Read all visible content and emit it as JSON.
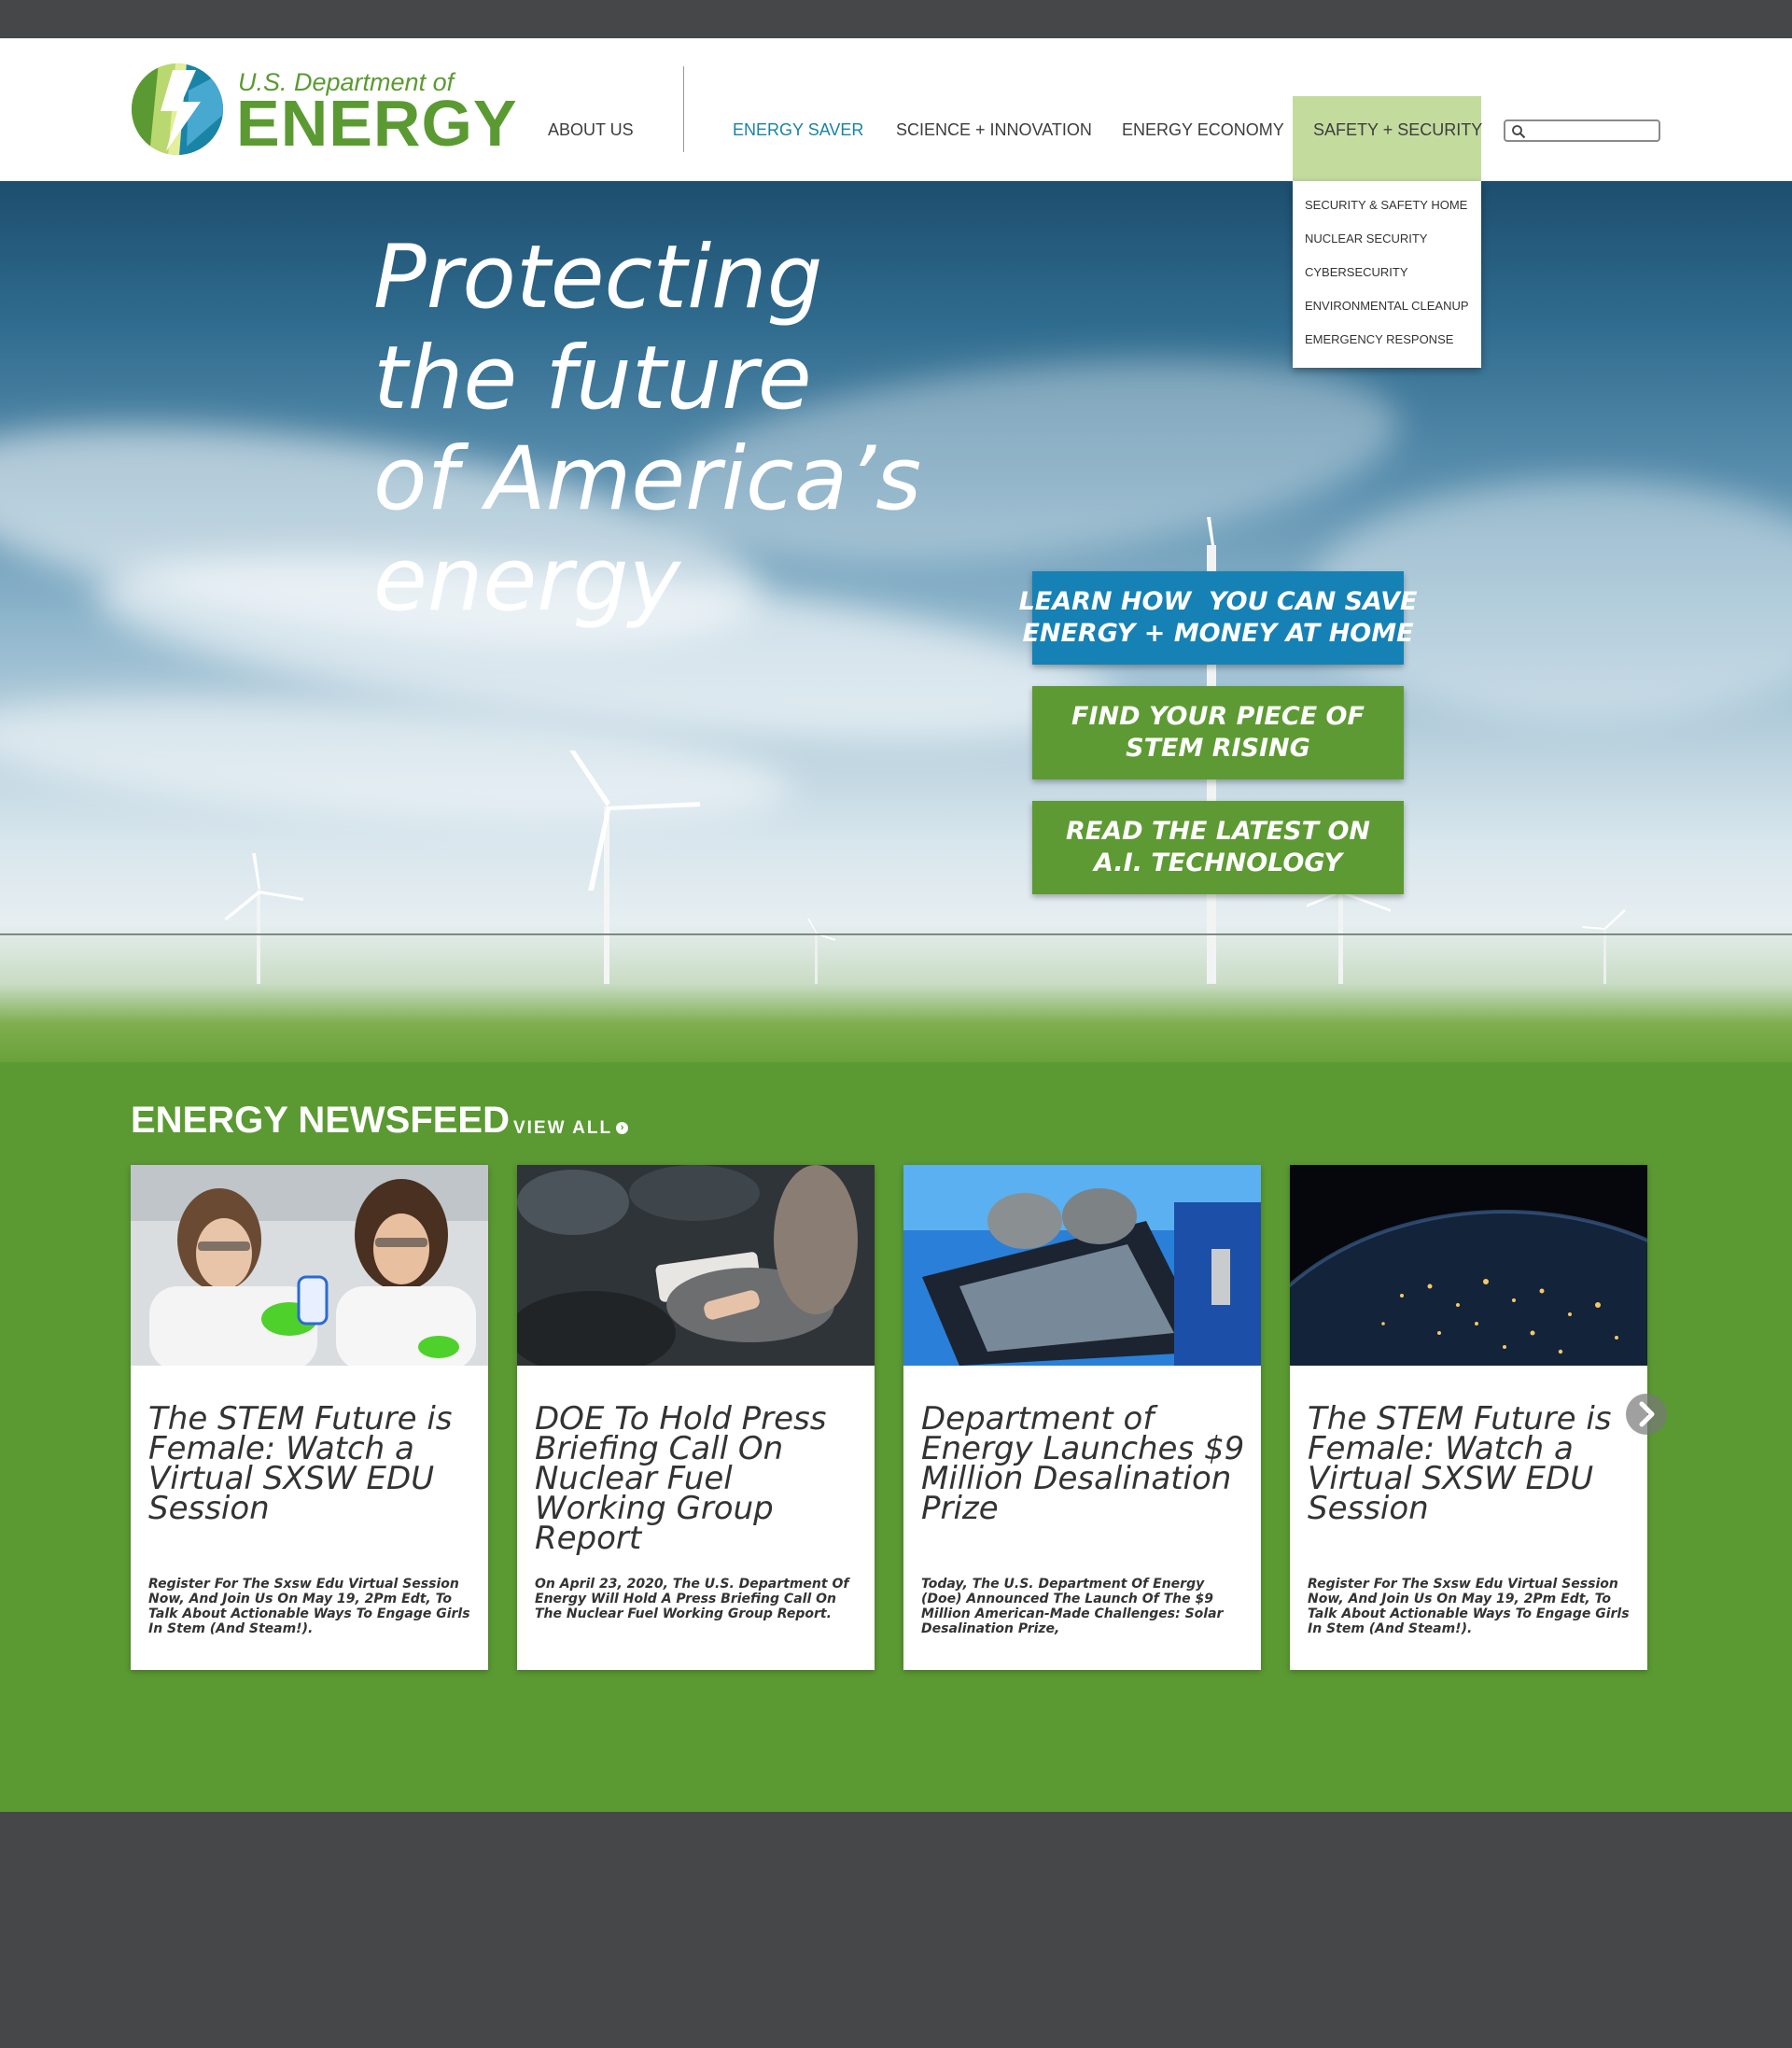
{
  "header": {
    "logo_small": "U.S. Department of",
    "logo_big": "ENERGY",
    "nav": [
      {
        "label": "ABOUT US"
      },
      {
        "label": "ENERGY SAVER"
      },
      {
        "label": "SCIENCE + INNOVATION"
      },
      {
        "label": "ENERGY ECONOMY"
      },
      {
        "label": "SAFETY + SECURITY"
      }
    ],
    "search_placeholder": ""
  },
  "dropdown": {
    "items": [
      {
        "label": "SECURITY & SAFETY HOME"
      },
      {
        "label": "NUCLEAR SECURITY"
      },
      {
        "label": "CYBERSECURITY"
      },
      {
        "label": "ENVIRONMENTAL CLEANUP"
      },
      {
        "label": "EMERGENCY RESPONSE"
      }
    ]
  },
  "hero": {
    "title_lines": [
      "Protecting",
      "the future",
      "of America’s",
      "energy"
    ],
    "ctas": [
      {
        "line1": "LEARN HOW  YOU CAN SAVE",
        "line2": "ENERGY + MONEY AT HOME"
      },
      {
        "line1": "FIND YOUR PIECE OF",
        "line2": "STEM RISING"
      },
      {
        "line1": "READ THE LATEST ON",
        "line2": "A.I. TECHNOLOGY"
      }
    ]
  },
  "newsfeed": {
    "title": "ENERGY NEWSFEED",
    "view_all": "VIEW ALL",
    "cards": [
      {
        "title": "The STEM Future is Female: Watch a Virtual SXSW EDU Session",
        "desc": "Register For The Sxsw Edu Virtual Session Now, And Join Us On May 19, 2Pm Edt, To Talk About Actionable Ways To Engage Girls In Stem (And Steam!)."
      },
      {
        "title": "DOE To Hold Press Briefing Call On Nuclear Fuel Working Group Report",
        "desc": "On April 23, 2020, The U.S. Department Of Energy Will Hold A Press Briefing Call On The Nuclear Fuel Working Group Report."
      },
      {
        "title": "Department of Energy Launches $9 Million Desalination Prize",
        "desc": "Today, The U.S. Department Of Energy (Doe) Announced The Launch Of The $9 Million American-Made Challenges: Solar Desalination Prize,"
      },
      {
        "title": "The STEM Future is Female: Watch a Virtual SXSW EDU Session",
        "desc": "Register For The Sxsw Edu Virtual Session Now, And Join Us On May 19, 2Pm Edt, To Talk About Actionable Ways To Engage Girls In Stem (And Steam!)."
      }
    ]
  },
  "colors": {
    "brand_green": "#5b9a32",
    "nav_active_blue": "#1a84a6",
    "safety_highlight": "#c3dc9e",
    "cta_blue": "#1681b5",
    "dark_gray": "#464749"
  },
  "icons": {
    "search": "search-icon",
    "view_all": "chevron-right-circle-icon",
    "carousel_next": "chevron-right-icon"
  }
}
